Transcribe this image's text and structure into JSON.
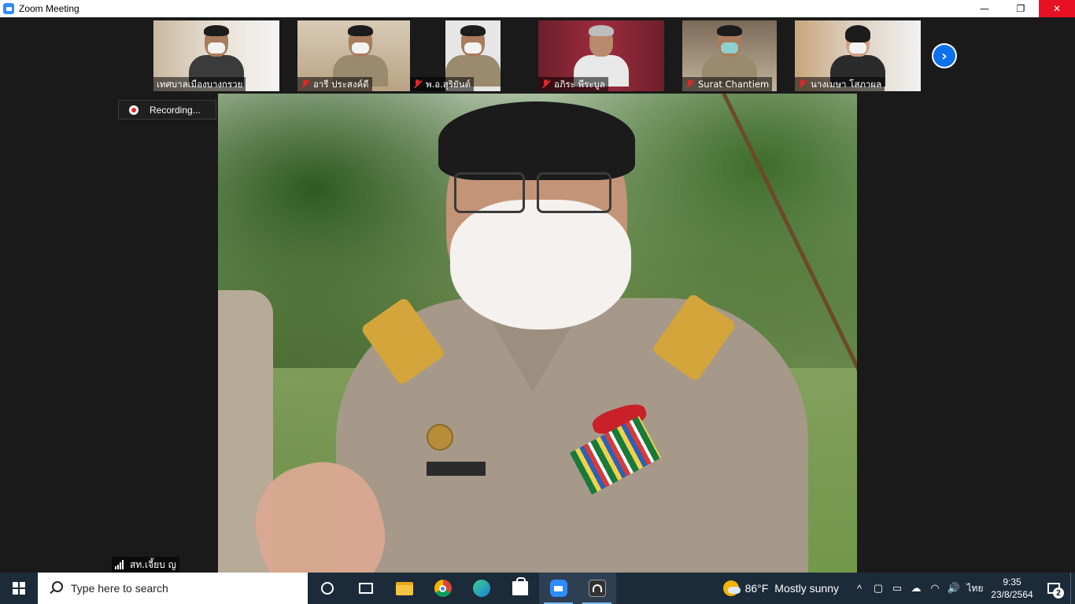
{
  "window": {
    "title": "Zoom Meeting",
    "minimize": "—",
    "restore": "❐",
    "close": "✕"
  },
  "participants": [
    {
      "name": "เทศบาลเมืองบางกรวย",
      "muted": false
    },
    {
      "name": "อารี ประสงค์ดี",
      "muted": true
    },
    {
      "name": "พ.อ.สุริยันต์",
      "muted": true
    },
    {
      "name": "อภิระ พีระบูล",
      "muted": true
    },
    {
      "name": "Surat Chantiem",
      "muted": true
    },
    {
      "name": "นางเมษา โสภาผล",
      "muted": true
    }
  ],
  "next_page_icon": "chevron-right-icon",
  "recording": {
    "label": "Recording..."
  },
  "active_speaker": {
    "name": "สท.เจี้ยบ ญ"
  },
  "taskbar": {
    "search_placeholder": "Type here to search",
    "weather": {
      "temperature": "86°F",
      "condition": "Mostly sunny"
    },
    "language": "ไทย",
    "time": "9:35",
    "date": "23/8/2564",
    "notifications_count": "2",
    "tray_up_arrow": "^",
    "volume_icon": "🔊"
  },
  "colors": {
    "zoom_blue": "#2d8cff",
    "close_red": "#e81123",
    "taskbar_bg": "#1c2b3a",
    "muted_red": "#e02828"
  }
}
